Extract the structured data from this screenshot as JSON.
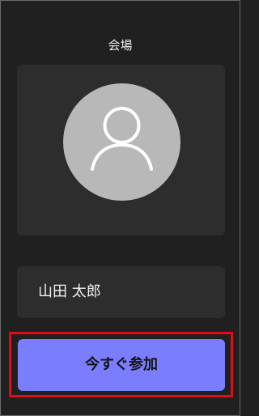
{
  "screen": {
    "title": "会場"
  },
  "preview": {
    "avatar_icon": "person-icon"
  },
  "participant": {
    "name": "山田 太郎"
  },
  "actions": {
    "join_label": "今すぐ参加",
    "highlight_color": "#e30b17",
    "button_color": "#7b7dff"
  }
}
